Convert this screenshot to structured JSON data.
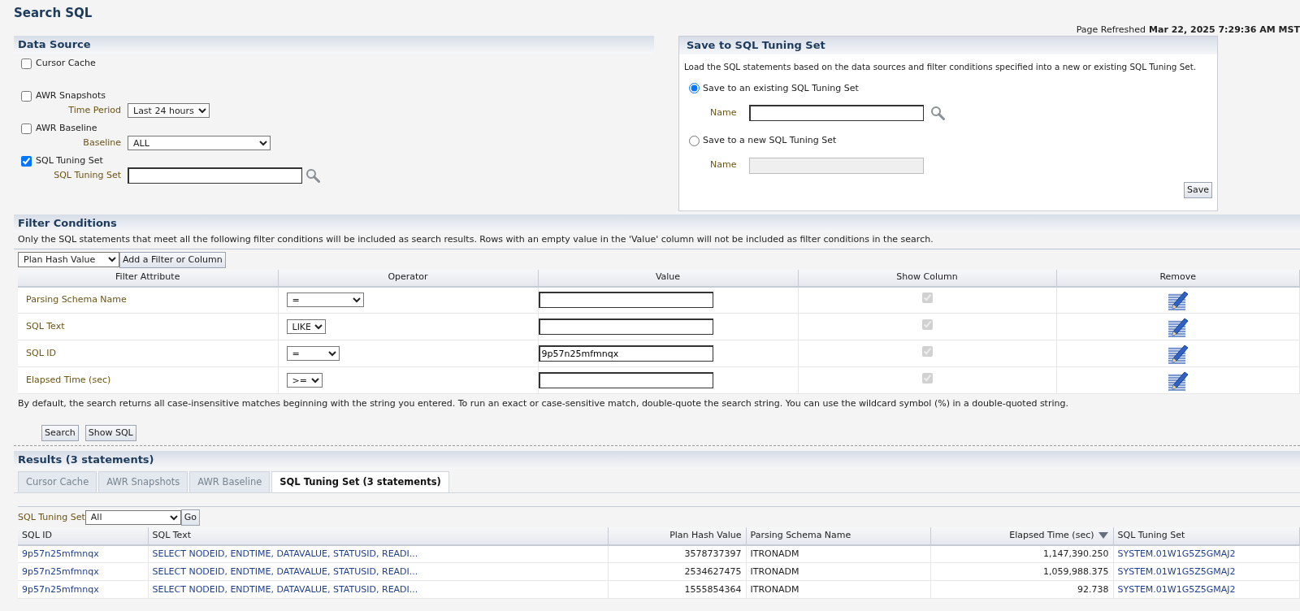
{
  "page_title": "Search SQL",
  "page_refreshed": {
    "label": "Page Refreshed",
    "value": "Mar 22, 2025 7:29:36 AM MST"
  },
  "data_source": {
    "title": "Data Source",
    "sources": [
      {
        "label": "Cursor Cache",
        "checked": false
      },
      {
        "label": "AWR Snapshots",
        "checked": false,
        "fields": [
          {
            "label": "Time Period",
            "kind": "select",
            "value": "Last 24 hours"
          }
        ]
      },
      {
        "label": "AWR Baseline",
        "checked": false,
        "fields": [
          {
            "label": "Baseline",
            "kind": "select",
            "value": "ALL"
          }
        ]
      },
      {
        "label": "SQL Tuning Set",
        "checked": true,
        "fields": [
          {
            "label": "SQL Tuning Set",
            "kind": "lookup"
          }
        ]
      }
    ]
  },
  "save_panel": {
    "title": "Save to SQL Tuning Set",
    "description": "Load the SQL statements based on the data sources and filter conditions specified into a new or existing SQL Tuning Set.",
    "options": [
      {
        "label": "Save to an existing SQL Tuning Set",
        "selected": true,
        "name_label": "Name"
      },
      {
        "label": "Save to a new SQL Tuning Set",
        "selected": false,
        "name_label": "Name"
      }
    ],
    "save_button": "Save"
  },
  "filter_conditions": {
    "title": "Filter Conditions",
    "description": "Only the SQL statements that meet all the following filter conditions will be included as search results. Rows with an empty value in the 'Value' column will not be included as filter conditions in the search.",
    "add_select": "Plan Hash Value",
    "add_button": "Add a Filter or Column",
    "columns": [
      "Filter Attribute",
      "Operator",
      "Value",
      "Show Column",
      "Remove"
    ],
    "rows": [
      {
        "attribute": "Parsing Schema Name",
        "operator": "=",
        "show_column": true,
        "show_column_disabled": true
      },
      {
        "attribute": "SQL Text",
        "operator": "LIKE",
        "show_column": true,
        "show_column_disabled": true
      },
      {
        "attribute": "SQL ID",
        "operator": "=",
        "value": "9p57n25mfmnqx",
        "show_column": true,
        "show_column_disabled": true
      },
      {
        "attribute": "Elapsed Time (sec)",
        "operator": ">=",
        "show_column": true,
        "show_column_disabled": true
      }
    ],
    "note": "By default, the search returns all case-insensitive matches beginning with the string you entered. To run an exact or case-sensitive match, double-quote the search string. You can use the wildcard symbol (%) in a double-quoted string.",
    "buttons": [
      "Search",
      "Show SQL"
    ]
  },
  "results": {
    "title": "Results (3 statements)",
    "tabs": [
      {
        "label": "Cursor Cache",
        "selected": false
      },
      {
        "label": "AWR Snapshots",
        "selected": false
      },
      {
        "label": "AWR Baseline",
        "selected": false
      },
      {
        "label": "SQL Tuning Set (3 statements)",
        "selected": true
      }
    ],
    "filter": {
      "label": "SQL Tuning Set",
      "value": "All",
      "button": "Go"
    },
    "columns": [
      {
        "label": "SQL ID",
        "kind": "link"
      },
      {
        "label": "SQL Text",
        "kind": "link"
      },
      {
        "label": "Plan Hash Value",
        "kind": "number"
      },
      {
        "label": "Parsing Schema Name",
        "kind": "text"
      },
      {
        "label": "Elapsed Time (sec)",
        "kind": "number",
        "sorted_descending": true
      },
      {
        "label": "SQL Tuning Set",
        "kind": "link"
      }
    ],
    "rows": [
      [
        "9p57n25mfmnqx",
        "SELECT NODEID, ENDTIME, DATAVALUE, STATUSID, READI...",
        "3578737397",
        "ITRONADM",
        "1,147,390.250",
        "SYSTEM.01W1G5Z5GMAJ2"
      ],
      [
        "9p57n25mfmnqx",
        "SELECT NODEID, ENDTIME, DATAVALUE, STATUSID, READI...",
        "2534627475",
        "ITRONADM",
        "1,059,988.375",
        "SYSTEM.01W1G5Z5GMAJ2"
      ],
      [
        "9p57n25mfmnqx",
        "SELECT NODEID, ENDTIME, DATAVALUE, STATUSID, READI...",
        "1555854364",
        "ITRONADM",
        "92.738",
        "SYSTEM.01W1G5Z5GMAJ2"
      ]
    ]
  }
}
